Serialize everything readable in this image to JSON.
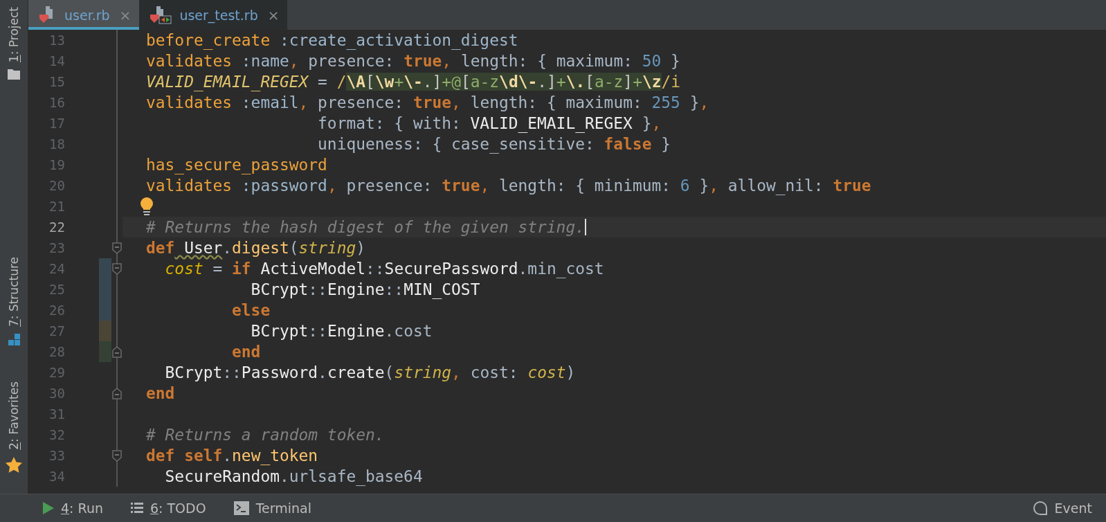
{
  "tabs": [
    {
      "label": "user.rb",
      "kind": "ruby",
      "selected": true,
      "close": "×"
    },
    {
      "label": "user_test.rb",
      "kind": "test",
      "selected": false,
      "close": "×"
    }
  ],
  "side_tools": [
    {
      "label": "1: Project",
      "kind": "folder",
      "mnemonic": true
    },
    {
      "label": "7: Structure",
      "kind": "structure",
      "mnemonic": true
    },
    {
      "label": "2: Favorites",
      "kind": "star",
      "mnemonic": true
    }
  ],
  "lines": [
    {
      "number": "13",
      "current": false,
      "intention": false,
      "tokens": [
        {
          "kind": "call",
          "text": "before_create"
        },
        {
          "kind": "sym",
          "text": " :create_activation_digest"
        }
      ]
    },
    {
      "number": "14",
      "current": false,
      "intention": false,
      "tokens": [
        {
          "kind": "call",
          "text": "validates"
        },
        {
          "kind": "sym",
          "text": " :name"
        },
        {
          "kind": "com",
          "text": ","
        },
        {
          "kind": "plain",
          "text": " presence: "
        },
        {
          "kind": "kw",
          "text": "true"
        },
        {
          "kind": "com",
          "text": ","
        },
        {
          "kind": "plain",
          "text": " length: { maximum: "
        },
        {
          "kind": "num",
          "text": "50"
        },
        {
          "kind": "plain",
          "text": " }"
        }
      ]
    },
    {
      "number": "15",
      "current": false,
      "intention": false,
      "tokens": [
        {
          "kind": "cdef",
          "text": "VALID_EMAIL_REGEX"
        },
        {
          "kind": "plain",
          "text": " = "
        },
        {
          "kind": "rxd",
          "text": "/"
        },
        {
          "kind": "rxe",
          "text": "\\A"
        },
        {
          "kind": "rx",
          "text": "["
        },
        {
          "kind": "rxe",
          "text": "\\w"
        },
        {
          "kind": "rxc",
          "text": "+"
        },
        {
          "kind": "rxe",
          "text": "\\-"
        },
        {
          "kind": "rx",
          "text": ".]"
        },
        {
          "kind": "rxc",
          "text": "+@"
        },
        {
          "kind": "rx",
          "text": "["
        },
        {
          "kind": "rxc",
          "text": "a-z"
        },
        {
          "kind": "rxe",
          "text": "\\d"
        },
        {
          "kind": "rxe",
          "text": "\\-"
        },
        {
          "kind": "rx",
          "text": ".]"
        },
        {
          "kind": "rxc",
          "text": "+"
        },
        {
          "kind": "rxe",
          "text": "\\."
        },
        {
          "kind": "rx",
          "text": "["
        },
        {
          "kind": "rxc",
          "text": "a-z"
        },
        {
          "kind": "rx",
          "text": "]"
        },
        {
          "kind": "rxc",
          "text": "+"
        },
        {
          "kind": "rxe",
          "text": "\\z"
        },
        {
          "kind": "rxd",
          "text": "/i"
        }
      ]
    },
    {
      "number": "16",
      "current": false,
      "intention": false,
      "tokens": [
        {
          "kind": "call",
          "text": "validates"
        },
        {
          "kind": "sym",
          "text": " :email"
        },
        {
          "kind": "com",
          "text": ","
        },
        {
          "kind": "plain",
          "text": " presence: "
        },
        {
          "kind": "kw",
          "text": "true"
        },
        {
          "kind": "com",
          "text": ","
        },
        {
          "kind": "plain",
          "text": " length: { maximum: "
        },
        {
          "kind": "num",
          "text": "255"
        },
        {
          "kind": "plain",
          "text": " }"
        },
        {
          "kind": "com",
          "text": ","
        }
      ]
    },
    {
      "number": "17",
      "current": false,
      "intention": false,
      "tokens": [
        {
          "kind": "plain",
          "text": "                  format: { with: "
        },
        {
          "kind": "const",
          "text": "VALID_EMAIL_REGEX"
        },
        {
          "kind": "plain",
          "text": " }"
        },
        {
          "kind": "com",
          "text": ","
        }
      ]
    },
    {
      "number": "18",
      "current": false,
      "intention": false,
      "tokens": [
        {
          "kind": "plain",
          "text": "                  uniqueness: { case_sensitive: "
        },
        {
          "kind": "kw",
          "text": "false"
        },
        {
          "kind": "plain",
          "text": " }"
        }
      ]
    },
    {
      "number": "19",
      "current": false,
      "intention": false,
      "tokens": [
        {
          "kind": "call",
          "text": "has_secure_password"
        }
      ]
    },
    {
      "number": "20",
      "current": false,
      "intention": false,
      "tokens": [
        {
          "kind": "call",
          "text": "validates"
        },
        {
          "kind": "sym",
          "text": " :password"
        },
        {
          "kind": "com",
          "text": ","
        },
        {
          "kind": "plain",
          "text": " presence: "
        },
        {
          "kind": "kw",
          "text": "true"
        },
        {
          "kind": "com",
          "text": ","
        },
        {
          "kind": "plain",
          "text": " length: { minimum: "
        },
        {
          "kind": "num",
          "text": "6"
        },
        {
          "kind": "plain",
          "text": " }"
        },
        {
          "kind": "com",
          "text": ","
        },
        {
          "kind": "plain",
          "text": " allow_nil: "
        },
        {
          "kind": "kw",
          "text": "true"
        }
      ]
    },
    {
      "number": "21",
      "current": false,
      "intention": true
    },
    {
      "number": "22",
      "current": true,
      "intention": false,
      "tokens": [
        {
          "kind": "comment",
          "text": "# Returns the hash digest of the given string."
        }
      ]
    },
    {
      "number": "23",
      "current": false,
      "intention": false,
      "fold": {
        "kind": "start"
      },
      "tokens": [
        {
          "kind": "kw",
          "text": "def"
        },
        {
          "kind": "warn",
          "text": " User"
        },
        {
          "kind": "plain",
          "text": "."
        },
        {
          "kind": "mdef",
          "text": "digest"
        },
        {
          "kind": "plain",
          "text": "("
        },
        {
          "kind": "param",
          "text": "string"
        },
        {
          "kind": "plain",
          "text": ")"
        }
      ]
    },
    {
      "number": "24",
      "current": false,
      "intention": false,
      "fold": {
        "kind": "start"
      },
      "color": "#374752",
      "tokens": [
        {
          "kind": "lvar",
          "text": "  cost"
        },
        {
          "kind": "plain",
          "text": " = "
        },
        {
          "kind": "kw",
          "text": "if"
        },
        {
          "kind": "const",
          "text": " ActiveModel"
        },
        {
          "kind": "plain",
          "text": "::"
        },
        {
          "kind": "const",
          "text": "SecurePassword"
        },
        {
          "kind": "plain",
          "text": ".min_cost"
        }
      ]
    },
    {
      "number": "25",
      "current": false,
      "intention": false,
      "color": "#374752",
      "tokens": [
        {
          "kind": "const",
          "text": "           BCrypt"
        },
        {
          "kind": "plain",
          "text": "::"
        },
        {
          "kind": "const",
          "text": "Engine"
        },
        {
          "kind": "plain",
          "text": "::"
        },
        {
          "kind": "const",
          "text": "MIN_COST"
        }
      ]
    },
    {
      "number": "26",
      "current": false,
      "intention": false,
      "color": "#374752",
      "tokens": [
        {
          "kind": "kw",
          "text": "         else"
        }
      ]
    },
    {
      "number": "27",
      "current": false,
      "intention": false,
      "color": "#4b4536",
      "tokens": [
        {
          "kind": "const",
          "text": "           BCrypt"
        },
        {
          "kind": "plain",
          "text": "::"
        },
        {
          "kind": "const",
          "text": "Engine"
        },
        {
          "kind": "plain",
          "text": ".cost"
        }
      ]
    },
    {
      "number": "28",
      "current": false,
      "intention": false,
      "fold": {
        "kind": "end"
      },
      "color": "#344134",
      "tokens": [
        {
          "kind": "kw",
          "text": "         end"
        }
      ]
    },
    {
      "number": "29",
      "current": false,
      "intention": false,
      "tokens": [
        {
          "kind": "const",
          "text": "  BCrypt"
        },
        {
          "kind": "plain",
          "text": "::"
        },
        {
          "kind": "const",
          "text": "Password"
        },
        {
          "kind": "plain",
          "text": "."
        },
        {
          "kind": "const",
          "text": "create"
        },
        {
          "kind": "plain",
          "text": "("
        },
        {
          "kind": "param",
          "text": "string"
        },
        {
          "kind": "com",
          "text": ","
        },
        {
          "kind": "plain",
          "text": " cost: "
        },
        {
          "kind": "param",
          "text": "cost"
        },
        {
          "kind": "plain",
          "text": ")"
        }
      ]
    },
    {
      "number": "30",
      "current": false,
      "intention": false,
      "fold": {
        "kind": "end"
      },
      "tokens": [
        {
          "kind": "kw",
          "text": "end"
        }
      ]
    },
    {
      "number": "31",
      "current": false,
      "intention": false
    },
    {
      "number": "32",
      "current": false,
      "intention": false,
      "tokens": [
        {
          "kind": "comment",
          "text": "# Returns a random token."
        }
      ]
    },
    {
      "number": "33",
      "current": false,
      "intention": false,
      "fold": {
        "kind": "start"
      },
      "tokens": [
        {
          "kind": "kw",
          "text": "def self"
        },
        {
          "kind": "plain",
          "text": "."
        },
        {
          "kind": "mdef",
          "text": "new_token"
        }
      ]
    },
    {
      "number": "34",
      "current": false,
      "intention": false,
      "tokens": [
        {
          "kind": "const",
          "text": "  SecureRandom"
        },
        {
          "kind": "plain",
          "text": ".urlsafe_base64"
        }
      ]
    }
  ],
  "bottom_tools": [
    {
      "label": "4: Run",
      "kind": "run",
      "mnemonic": true
    },
    {
      "label": "6: TODO",
      "kind": "todo",
      "mnemonic": true
    },
    {
      "label": "Terminal",
      "kind": "terminal",
      "mnemonic": false
    }
  ],
  "bottom_right": {
    "label": "Event",
    "kind": "event"
  }
}
